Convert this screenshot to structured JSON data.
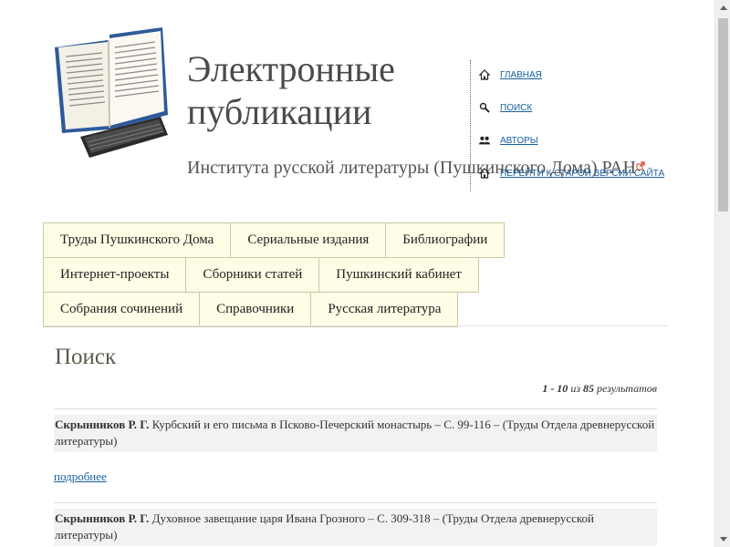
{
  "header": {
    "title_line1": "Электронные",
    "title_line2": "публикации",
    "subtitle": "Института русской литературы (Пушкинского Дома) РАН"
  },
  "quicknav": {
    "items": [
      {
        "label": "ГЛАВНАЯ",
        "icon": "home-icon"
      },
      {
        "label": "ПОИСК",
        "icon": "search-icon"
      },
      {
        "label": "АВТОРЫ",
        "icon": "authors-icon"
      },
      {
        "label": "ПЕРЕЙТИ К СТАРОЙ ВЕРСИИ САЙТА",
        "icon": "home-icon"
      }
    ]
  },
  "menu": {
    "rows": [
      [
        "Труды Пушкинского Дома",
        "Сериальные издания",
        "Библиографии"
      ],
      [
        "Интернет-проекты",
        "Сборники статей",
        "Пушкинский кабинет"
      ],
      [
        "Собрания сочинений",
        "Справочники",
        "Русская литература"
      ]
    ]
  },
  "main": {
    "heading": "Поиск",
    "results_range": "1 - 10",
    "results_of": "из",
    "results_total": "85",
    "results_word": "результатов",
    "results": [
      {
        "author": "Скрынников Р. Г.",
        "title": "Курбский и его письма в Псково-Печерский монастырь – С. 99-116 – (Труды Отдела древнерусской литературы)",
        "more": "подробнее"
      },
      {
        "author": "Скрынников Р. Г.",
        "title": "Духовное завещание царя Ивана Грозного – С. 309-318 – (Труды Отдела древнерусской литературы)",
        "more": ""
      }
    ]
  },
  "colors": {
    "tab_bg": "#fffde6",
    "tab_border": "#c9c6a8",
    "link": "#1a5fa0",
    "result_bg": "#f2f2f2"
  }
}
